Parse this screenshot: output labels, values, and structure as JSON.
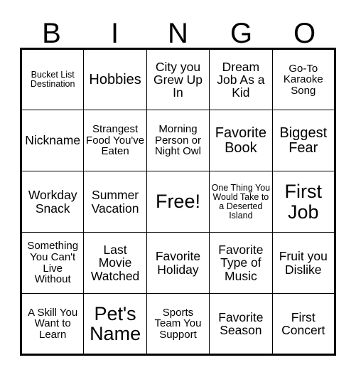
{
  "header": {
    "letters": [
      "B",
      "I",
      "N",
      "G",
      "O"
    ]
  },
  "grid": {
    "rows": [
      {
        "cells": [
          {
            "text": "Bucket List Destination",
            "size": "xs"
          },
          {
            "text": "Hobbies",
            "size": "lg"
          },
          {
            "text": "City you Grew Up In",
            "size": "md"
          },
          {
            "text": "Dream Job As a Kid",
            "size": "md"
          },
          {
            "text": "Go-To Karaoke Song",
            "size": "sm"
          }
        ]
      },
      {
        "cells": [
          {
            "text": "Nickname",
            "size": "md"
          },
          {
            "text": "Strangest Food You've Eaten",
            "size": "sm"
          },
          {
            "text": "Morning Person or Night Owl",
            "size": "sm"
          },
          {
            "text": "Favorite Book",
            "size": "lg"
          },
          {
            "text": "Biggest Fear",
            "size": "lg"
          }
        ]
      },
      {
        "cells": [
          {
            "text": "Workday Snack",
            "size": "md"
          },
          {
            "text": "Summer Vacation",
            "size": "md"
          },
          {
            "text": "Free!",
            "size": "xl"
          },
          {
            "text": "One Thing You Would Take to a Deserted Island",
            "size": "xs"
          },
          {
            "text": "First Job",
            "size": "xl"
          }
        ]
      },
      {
        "cells": [
          {
            "text": "Something You Can't Live Without",
            "size": "sm"
          },
          {
            "text": "Last Movie Watched",
            "size": "md"
          },
          {
            "text": "Favorite Holiday",
            "size": "md"
          },
          {
            "text": "Favorite Type of Music",
            "size": "md"
          },
          {
            "text": "Fruit you Dislike",
            "size": "md"
          }
        ]
      },
      {
        "cells": [
          {
            "text": "A Skill You Want to Learn",
            "size": "sm"
          },
          {
            "text": "Pet's Name",
            "size": "xl"
          },
          {
            "text": "Sports Team You Support",
            "size": "sm"
          },
          {
            "text": "Favorite Season",
            "size": "md"
          },
          {
            "text": "First Concert",
            "size": "md"
          }
        ]
      }
    ]
  },
  "colors": {
    "ink": "#000000",
    "paper": "#ffffff"
  }
}
